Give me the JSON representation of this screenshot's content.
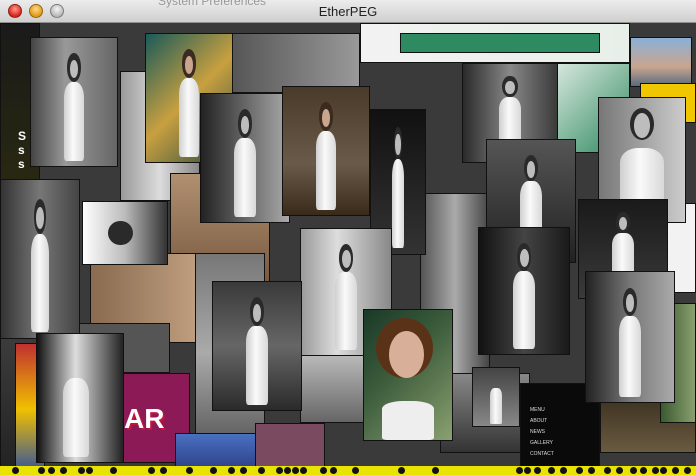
{
  "window": {
    "title": "EtherPEG",
    "ghost_title": "System Preferences"
  },
  "colors": {
    "strip": "#e8e300",
    "titlebar_top": "#ececec",
    "titlebar_bottom": "#cfcfcf"
  },
  "icons": [
    "close-icon",
    "minimize-icon",
    "zoom-icon"
  ],
  "captured_text": {
    "banner": "AR",
    "menu_items": [
      "MENU",
      "ABOUT",
      "NEWS",
      "GALLERY",
      "CONTACT"
    ],
    "side_letters": [
      "S",
      "s",
      "s"
    ]
  }
}
